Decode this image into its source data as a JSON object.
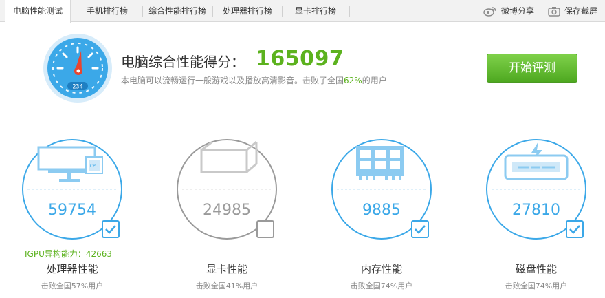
{
  "tabs": [
    {
      "label": "电脑性能测试",
      "active": true
    },
    {
      "label": "手机排行榜",
      "active": false
    },
    {
      "label": "综合性能排行榜",
      "active": false
    },
    {
      "label": "处理器排行榜",
      "active": false
    },
    {
      "label": "显卡排行榜",
      "active": false
    }
  ],
  "toolbar": {
    "weibo_share": "微博分享",
    "save_screenshot": "保存截屏"
  },
  "summary": {
    "gauge_readout": "234",
    "label": "电脑综合性能得分：",
    "score": "165097",
    "desc_before": "本电脑可以流畅运行一般游戏以及播放高清影音。击败了全国",
    "desc_pct": "62%",
    "desc_after": "的用户",
    "start_button": "开始评测"
  },
  "components": [
    {
      "name": "处理器性能",
      "score": "59754",
      "beat": "击败全国57%用户",
      "checked": true,
      "icon": "monitor-cpu-icon"
    },
    {
      "name": "显卡性能",
      "score": "24985",
      "beat": "击败全国41%用户",
      "checked": false,
      "icon": "graphics-card-icon"
    },
    {
      "name": "内存性能",
      "score": "9885",
      "beat": "击败全国74%用户",
      "checked": true,
      "icon": "memory-chip-icon"
    },
    {
      "name": "磁盘性能",
      "score": "27810",
      "beat": "击败全国74%用户",
      "checked": true,
      "icon": "disk-drive-icon"
    }
  ],
  "igpu": "IGPU异构能力：42663",
  "colors": {
    "accent_blue": "#3ba8e8",
    "inactive_gray": "#9a9a9a",
    "success_green": "#5cb21e"
  }
}
